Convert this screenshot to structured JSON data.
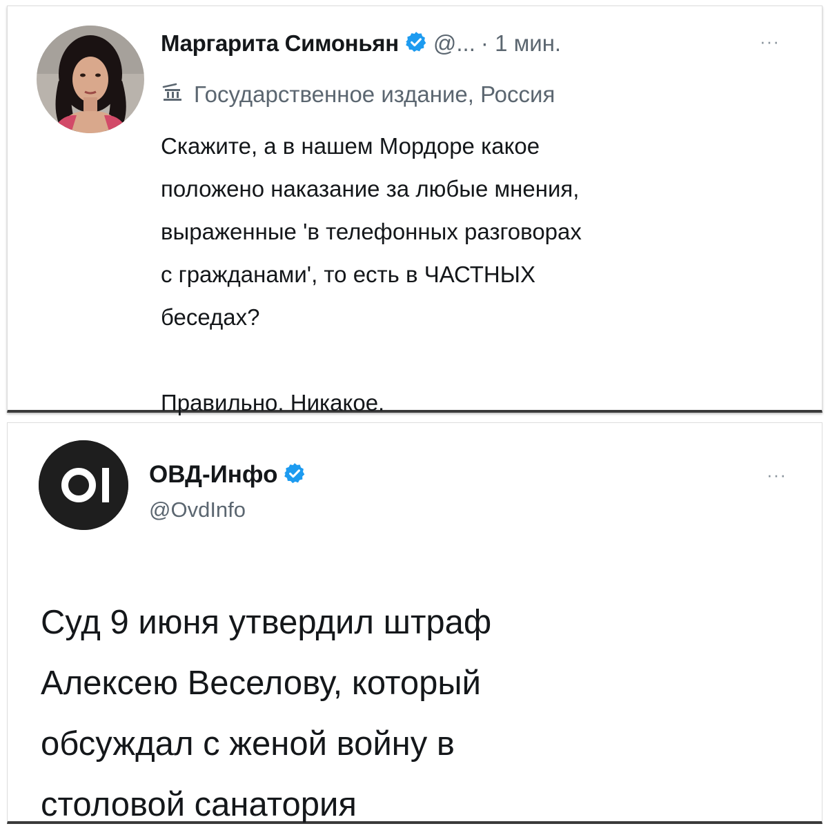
{
  "tweet1": {
    "author_name": "Маргарита Симоньян",
    "handle_truncated": "@...",
    "time": "· 1 мин.",
    "more_label": "···",
    "state_label": "Государственное издание, Россия",
    "text_lines": [
      "Скажите, а в нашем Мордоре какое",
      "положено наказание за любые мнения,",
      "выраженные 'в телефонных разговорах",
      "с гражданами', то есть в ЧАСТНЫХ",
      "беседах?"
    ],
    "text_line_final": "Правильно. Никакое.",
    "icons": {
      "verified": "verified-badge-icon",
      "state_label": "government-building-icon"
    }
  },
  "tweet2": {
    "author_name": "ОВД-Инфо",
    "handle": "@OvdInfo",
    "more_label": "···",
    "text_lines": [
      "Суд 9 июня утвердил штраф",
      "Алексею Веселову, который",
      "обсуждал с женой войну в",
      "столовой санатория"
    ],
    "icons": {
      "verified": "verified-badge-icon",
      "avatar_logo": "ovd-info-logo-icon"
    }
  },
  "colors": {
    "text_primary": "#14171a",
    "text_secondary": "#5b6670",
    "verified_blue": "#1d9bf0",
    "ovd_logo_bg": "#1e1e1e"
  }
}
